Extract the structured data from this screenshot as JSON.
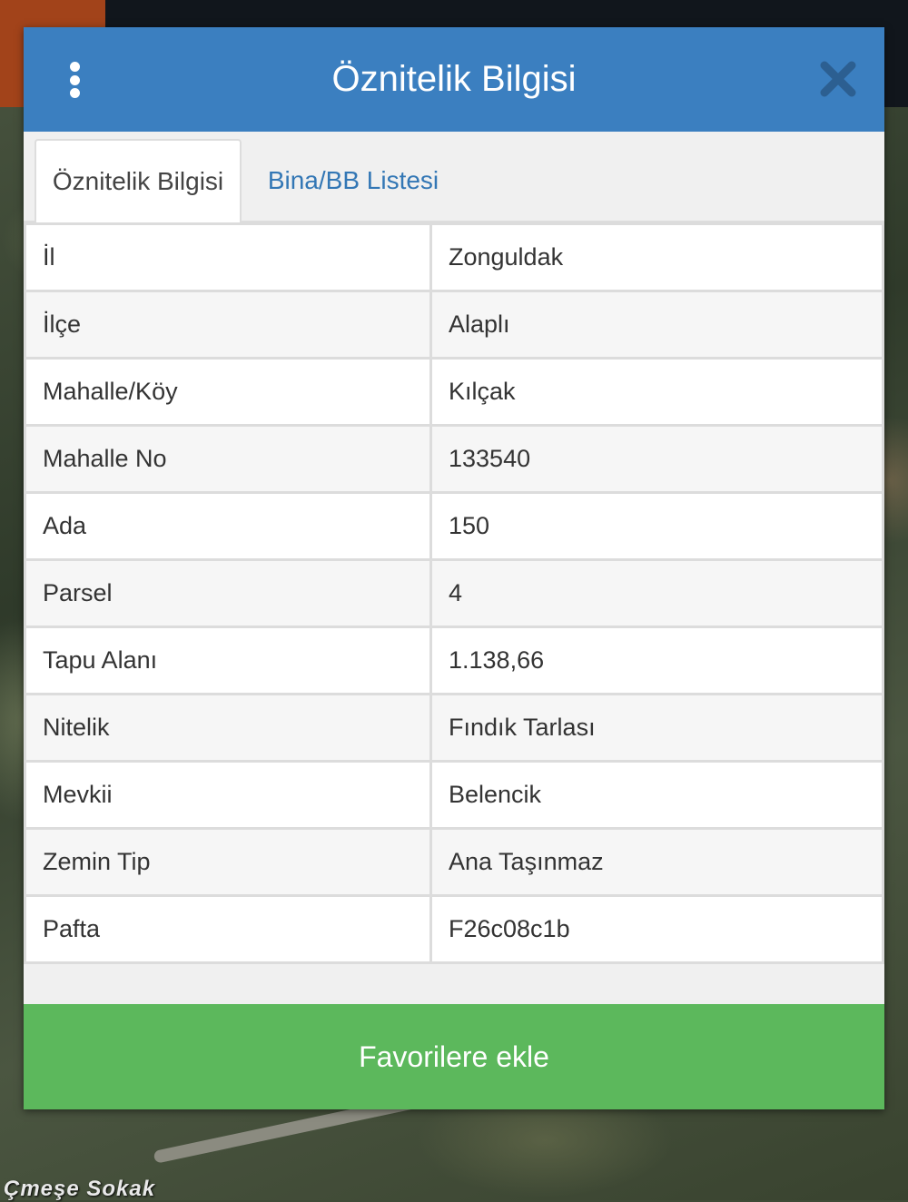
{
  "map": {
    "street_label": "Çmeşe Sokak"
  },
  "modal": {
    "title": "Öznitelik Bilgisi",
    "menu_icon": "more-vertical-icon",
    "close_icon": "close-icon",
    "header_color": "#3b7fc0"
  },
  "tabs": [
    {
      "label": "Öznitelik Bilgisi",
      "active": true
    },
    {
      "label": "Bina/BB Listesi",
      "active": false
    }
  ],
  "attributes": [
    {
      "key": "İl",
      "value": "Zonguldak"
    },
    {
      "key": "İlçe",
      "value": "Alaplı"
    },
    {
      "key": "Mahalle/Köy",
      "value": "Kılçak"
    },
    {
      "key": "Mahalle No",
      "value": "133540"
    },
    {
      "key": "Ada",
      "value": "150"
    },
    {
      "key": "Parsel",
      "value": "4"
    },
    {
      "key": "Tapu Alanı",
      "value": "1.138,66"
    },
    {
      "key": "Nitelik",
      "value": "Fındık Tarlası"
    },
    {
      "key": "Mevkii",
      "value": "Belencik"
    },
    {
      "key": "Zemin Tip",
      "value": "Ana Taşınmaz"
    },
    {
      "key": "Pafta",
      "value": "F26c08c1b"
    }
  ],
  "footer": {
    "favorite_label": "Favorilere ekle",
    "button_color": "#5cb85c"
  }
}
